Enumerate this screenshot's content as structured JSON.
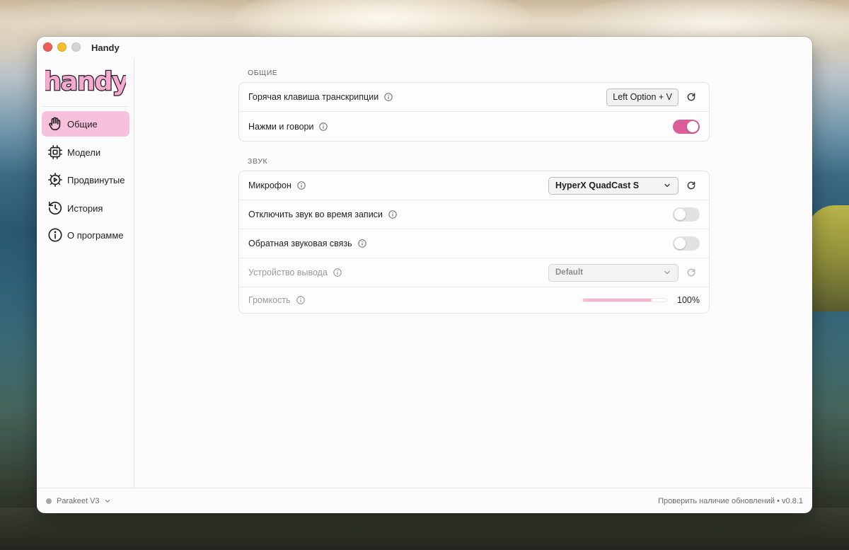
{
  "window": {
    "title": "Handy"
  },
  "sidebar": {
    "logo_text": "handy",
    "items": [
      {
        "label": "Общие",
        "icon": "hand-icon",
        "active": true
      },
      {
        "label": "Модели",
        "icon": "chip-icon",
        "active": false
      },
      {
        "label": "Продвинутые",
        "icon": "gear-play-icon",
        "active": false
      },
      {
        "label": "История",
        "icon": "history-icon",
        "active": false
      },
      {
        "label": "О программе",
        "icon": "info-icon",
        "active": false
      }
    ]
  },
  "general": {
    "title": "ОБЩИЕ",
    "hotkey": {
      "label": "Горячая клавиша транскрипции",
      "value": "Left Option + V"
    },
    "push_to_talk": {
      "label": "Нажми и говори",
      "enabled": true
    }
  },
  "sound": {
    "title": "ЗВУК",
    "microphone": {
      "label": "Микрофон",
      "value": "HyperX QuadCast S"
    },
    "mute_while_recording": {
      "label": "Отключить звук во время записи",
      "enabled": false
    },
    "audio_feedback": {
      "label": "Обратная звуковая связь",
      "enabled": false
    },
    "output_device": {
      "label": "Устройство вывода",
      "value": "Default"
    },
    "volume": {
      "label": "Громкость",
      "value": 1.0,
      "display": "100%"
    }
  },
  "footer": {
    "model": "Parakeet V3",
    "update_text": "Проверить наличие обновлений • v0.8.1"
  },
  "colors": {
    "accent": "#dc5c99",
    "active_nav": "#f7c0dd",
    "slider_fill": "#f3b6d4"
  }
}
